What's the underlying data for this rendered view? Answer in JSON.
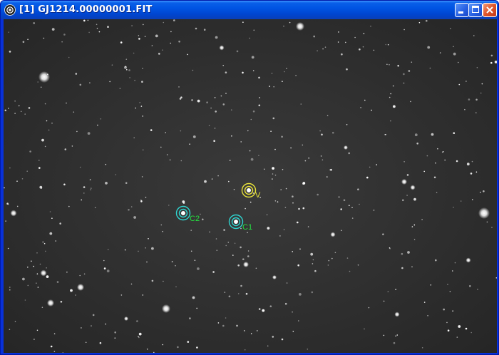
{
  "window": {
    "title": "[1] GJ1214.00000001.FIT",
    "icon": "camera-lens-icon",
    "controls": {
      "minimize": "minimize-icon",
      "maximize": "maximize-icon",
      "close": "close-icon"
    }
  },
  "image": {
    "background_color": "#2e2e2e",
    "apertures": [
      {
        "label": "V",
        "color": "#e8e23a"
      },
      {
        "label": "C2",
        "color": "#2fd4cf"
      },
      {
        "label": "C1",
        "color": "#2fd4cf"
      }
    ],
    "label_color": "#24e040"
  }
}
